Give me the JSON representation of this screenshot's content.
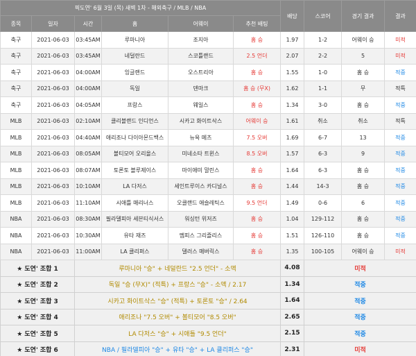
{
  "header": {
    "title": "픽도연' 6월 3일 (목) 새벽 1차 - 해외축구 / MLB / NBA",
    "columns": {
      "sport": "종목",
      "date": "일자",
      "time": "시간",
      "home": "홈",
      "away": "어웨이",
      "pick": "추천 배팅",
      "odds": "배당",
      "score": "스코어",
      "game_result": "경기 결과",
      "result": "결과"
    }
  },
  "games": [
    {
      "sport": "축구",
      "date": "2021-06-03",
      "time": "03:45AM",
      "home": "루마니아",
      "away": "조지아",
      "pick": "홈 승",
      "odds": "1.97",
      "score": "1-2",
      "game_result": "어웨이 승",
      "result": "미적",
      "hit": false
    },
    {
      "sport": "축구",
      "date": "2021-06-03",
      "time": "03:45AM",
      "home": "네덜란드",
      "away": "스코틀랜드",
      "pick": "2.5 언더",
      "odds": "2.07",
      "score": "2-2",
      "game_result": "5",
      "result": "미적",
      "hit": false
    },
    {
      "sport": "축구",
      "date": "2021-06-03",
      "time": "04:00AM",
      "home": "잉글랜드",
      "away": "오스트리아",
      "pick": "홈 승",
      "odds": "1.55",
      "score": "1-0",
      "game_result": "홈 승",
      "result": "적중",
      "hit": true
    },
    {
      "sport": "축구",
      "date": "2021-06-03",
      "time": "04:00AM",
      "home": "독일",
      "away": "덴마크",
      "pick": "홈 승 (무X)",
      "odds": "1.62",
      "score": "1-1",
      "game_result": "무",
      "result": "적특",
      "hit": null
    },
    {
      "sport": "축구",
      "date": "2021-06-03",
      "time": "04:05AM",
      "home": "프랑스",
      "away": "웨일스",
      "pick": "홈 승",
      "odds": "1.34",
      "score": "3-0",
      "game_result": "홈 승",
      "result": "적중",
      "hit": true
    },
    {
      "sport": "MLB",
      "date": "2021-06-03",
      "time": "02:10AM",
      "home": "클리블랜드 인디언스",
      "away": "시카고 화이트삭스",
      "pick": "어웨이 승",
      "odds": "1.61",
      "score": "취소",
      "game_result": "취소",
      "result": "적특",
      "hit": null
    },
    {
      "sport": "MLB",
      "date": "2021-06-03",
      "time": "04:40AM",
      "home": "애리조나 다이아몬드백스",
      "away": "뉴욕 메츠",
      "pick": "7.5 오버",
      "odds": "1.69",
      "score": "6-7",
      "game_result": "13",
      "result": "적중",
      "hit": true
    },
    {
      "sport": "MLB",
      "date": "2021-06-03",
      "time": "08:05AM",
      "home": "볼티모어 오리올스",
      "away": "미네소타 트윈스",
      "pick": "8.5 오버",
      "odds": "1.57",
      "score": "6-3",
      "game_result": "9",
      "result": "적중",
      "hit": true
    },
    {
      "sport": "MLB",
      "date": "2021-06-03",
      "time": "08:07AM",
      "home": "토론토 블루제이스",
      "away": "마이애미 말린스",
      "pick": "홈 승",
      "odds": "1.64",
      "score": "6-3",
      "game_result": "홈 승",
      "result": "적중",
      "hit": true
    },
    {
      "sport": "MLB",
      "date": "2021-06-03",
      "time": "10:10AM",
      "home": "LA 다저스",
      "away": "세인트루이스 카디널스",
      "pick": "홈 승",
      "odds": "1.44",
      "score": "14-3",
      "game_result": "홈 승",
      "result": "적중",
      "hit": true
    },
    {
      "sport": "MLB",
      "date": "2021-06-03",
      "time": "11:10AM",
      "home": "시애틀 매리너스",
      "away": "오클랜드 애슬레틱스",
      "pick": "9.5 언더",
      "odds": "1.49",
      "score": "0-6",
      "game_result": "6",
      "result": "적중",
      "hit": true
    },
    {
      "sport": "NBA",
      "date": "2021-06-03",
      "time": "08:30AM",
      "home": "필라델피아 세븐티식서스",
      "away": "워싱턴 위저즈",
      "pick": "홈 승",
      "odds": "1.04",
      "score": "129-112",
      "game_result": "홈 승",
      "result": "적중",
      "hit": true
    },
    {
      "sport": "NBA",
      "date": "2021-06-03",
      "time": "10:30AM",
      "home": "유타 재즈",
      "away": "멤피스 그리즐리스",
      "pick": "홈 승",
      "odds": "1.51",
      "score": "126-110",
      "game_result": "홈 승",
      "result": "적중",
      "hit": true
    },
    {
      "sport": "NBA",
      "date": "2021-06-03",
      "time": "11:00AM",
      "home": "LA 클리퍼스",
      "away": "댈러스 매버릭스",
      "pick": "홈 승",
      "odds": "1.35",
      "score": "100-105",
      "game_result": "어웨이 승",
      "result": "미적",
      "hit": false
    }
  ],
  "combos": [
    {
      "name": "★ 도연' 조합 1",
      "desc": "루마니아 \"승\" + 네덜란드 \"2.5 언더\" - 소액",
      "odds": "4.08",
      "result": "미적",
      "hit": false,
      "blue": false
    },
    {
      "name": "★ 도연' 조합 2",
      "desc": "독일 \"승 (무X)\" (적특) + 프랑스 \"승\" - 소액 / 2.17",
      "odds": "1.34",
      "result": "적중",
      "hit": true,
      "blue": false
    },
    {
      "name": "★ 도연' 조합 3",
      "desc": "시카고 화이트삭스 \"승\" (적특) + 토론토 \"승\" / 2.64",
      "odds": "1.64",
      "result": "적중",
      "hit": true,
      "blue": false
    },
    {
      "name": "★ 도연' 조합 4",
      "desc": "애리조나 \"7.5 오버\" + 볼티모어 \"8.5 오버\"",
      "odds": "2.65",
      "result": "적중",
      "hit": true,
      "blue": false
    },
    {
      "name": "★ 도연' 조합 5",
      "desc": "LA 다저스 \"승\" + 시애틀 \"9.5 언더\"",
      "odds": "2.15",
      "result": "적중",
      "hit": true,
      "blue": false
    },
    {
      "name": "★ 도연' 조합 6",
      "desc": "NBA / 필라델피아 \"승\" + 유타 \"승\" + LA 클리퍼스 \"승\"",
      "odds": "2.31",
      "result": "미적",
      "hit": false,
      "blue": true
    }
  ]
}
